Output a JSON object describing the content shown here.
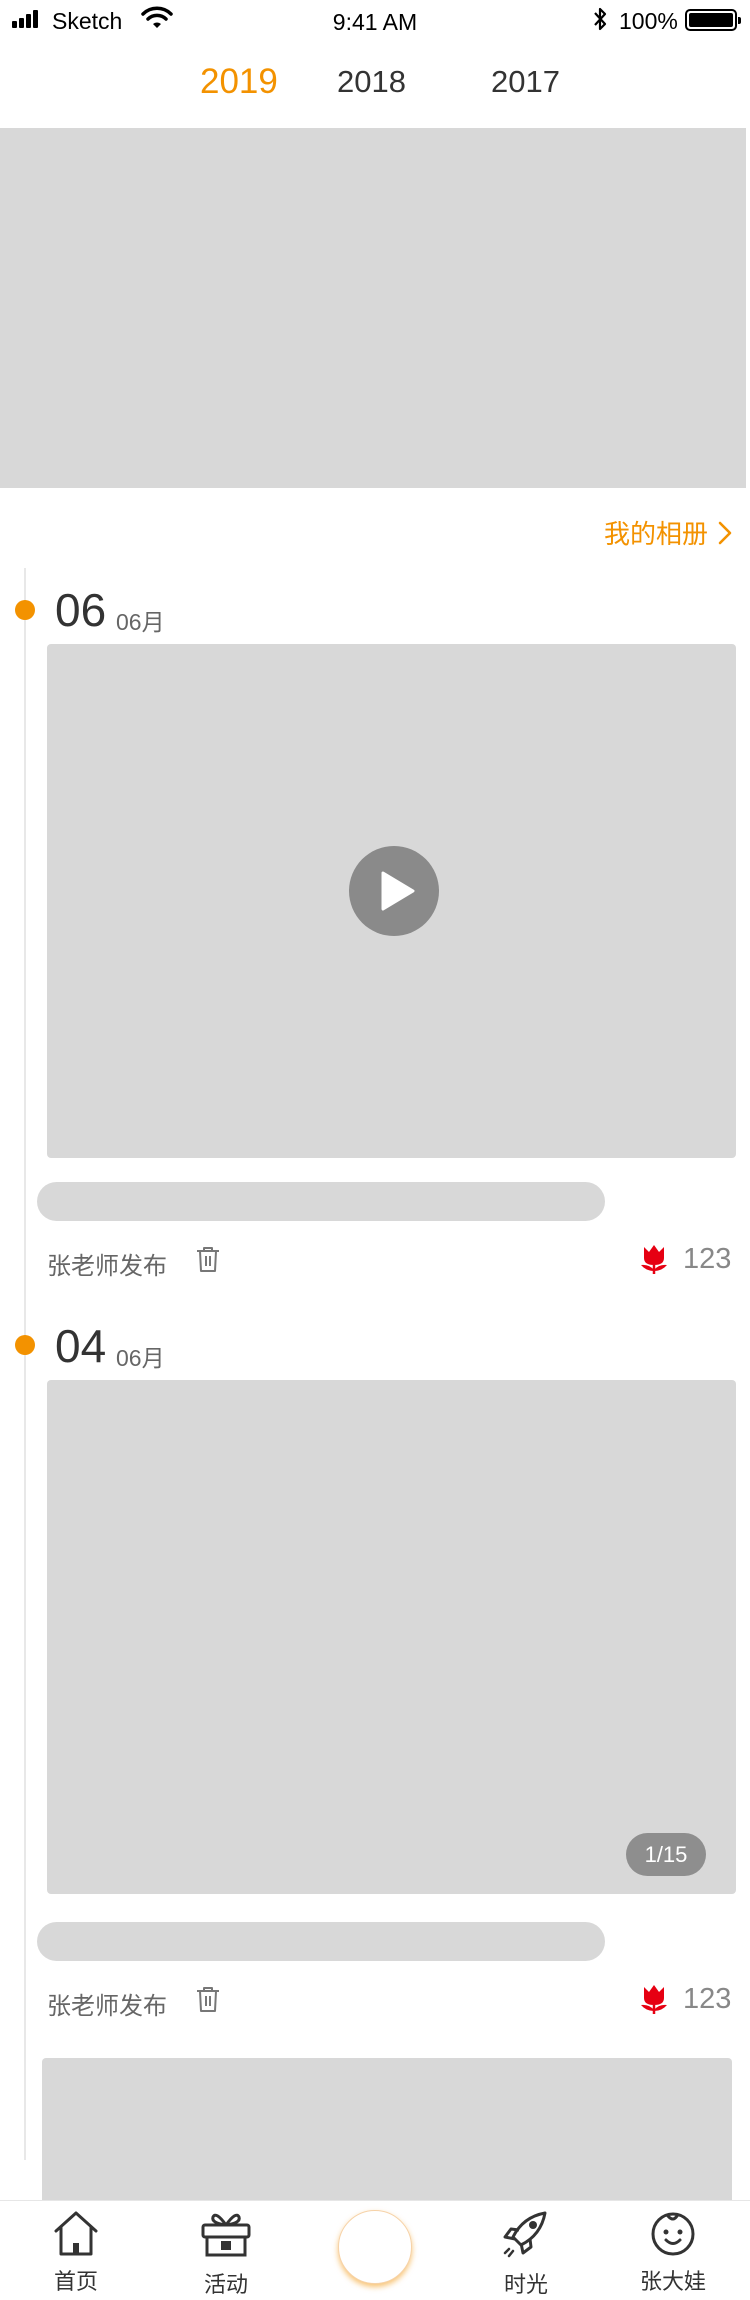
{
  "status_bar": {
    "carrier": "Sketch",
    "time": "9:41 AM",
    "battery": "100%"
  },
  "years": {
    "tabs": [
      "2019",
      "2018",
      "2017"
    ],
    "active": "2019"
  },
  "album_link": "我的相册",
  "posts": [
    {
      "day": "06",
      "month": "06月",
      "media": "video",
      "poster": "张老师发布",
      "likes": "123"
    },
    {
      "day": "04",
      "month": "06月",
      "media": "album",
      "media_counter": "1/15",
      "poster": "张老师发布",
      "likes": "123"
    }
  ],
  "tab_bar": {
    "items": [
      {
        "label": "首页",
        "icon": "home-icon"
      },
      {
        "label": "活动",
        "icon": "gift-icon"
      },
      {
        "label": "",
        "icon": "center-circle"
      },
      {
        "label": "时光",
        "icon": "rocket-icon"
      },
      {
        "label": "张大娃",
        "icon": "baby-face-icon"
      }
    ]
  },
  "colors": {
    "accent": "#F39200",
    "placeholder": "#D8D8D8",
    "like_red": "#E60012"
  }
}
